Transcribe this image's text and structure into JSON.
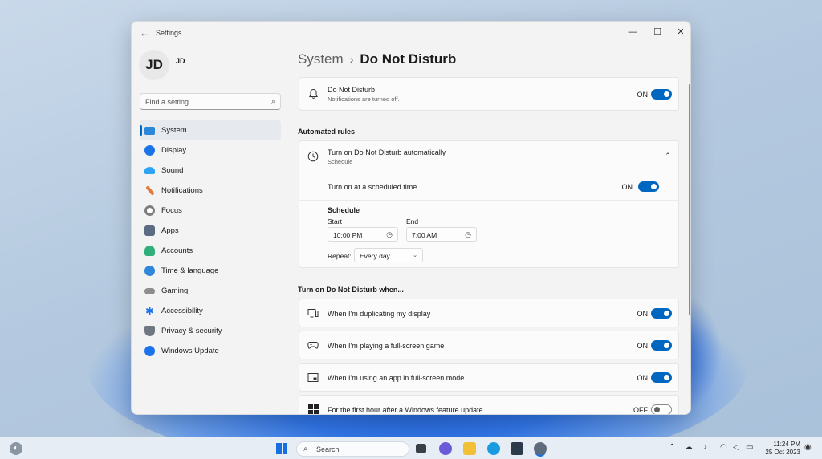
{
  "window": {
    "title": "Settings",
    "controls": {
      "minimize": "—",
      "maximize": "☐",
      "close": "✕"
    }
  },
  "user": {
    "initials": "JD",
    "name": "JD"
  },
  "search": {
    "placeholder": "Find a setting"
  },
  "sidebar": {
    "items": [
      {
        "label": "System",
        "icon": "system-icon",
        "color": "#2b88d8",
        "active": true
      },
      {
        "label": "Display",
        "icon": "bluetooth-icon",
        "color": "#1a73e8"
      },
      {
        "label": "Sound",
        "icon": "network-icon",
        "color": "#2ea3f2"
      },
      {
        "label": "Notifications",
        "icon": "personalization-brush-icon",
        "color": "#e07a3a"
      },
      {
        "label": "Focus",
        "icon": "focus-icon",
        "color": "#7d7d7d"
      },
      {
        "label": "Apps",
        "icon": "apps-icon",
        "color": "#5a6b82"
      },
      {
        "label": "Accounts",
        "icon": "accounts-icon",
        "color": "#2fb07a"
      },
      {
        "label": "Time & language",
        "icon": "time-language-icon",
        "color": "#2f87d9"
      },
      {
        "label": "Gaming",
        "icon": "gaming-icon",
        "color": "#8d8d8d"
      },
      {
        "label": "Accessibility",
        "icon": "accessibility-icon",
        "color": "#1a73e8"
      },
      {
        "label": "Privacy & security",
        "icon": "shield-icon",
        "color": "#6f7782"
      },
      {
        "label": "Windows Update",
        "icon": "windows-update-icon",
        "color": "#1a73e8"
      }
    ]
  },
  "breadcrumb": {
    "parent": "System",
    "separator": "›",
    "current": "Do Not Disturb"
  },
  "dnd": {
    "title": "Do Not Disturb",
    "subtitle": "Notifications are turned off.",
    "state": "ON"
  },
  "automated": {
    "heading": "Automated rules",
    "rule_title": "Turn on Do Not Disturb automatically",
    "rule_subtitle": "Schedule",
    "scheduled_label": "Turn on at a scheduled time",
    "scheduled_state": "ON",
    "schedule_heading": "Schedule",
    "start_label": "Start",
    "start_value": "10:00 PM",
    "end_label": "End",
    "end_value": "7:00 AM",
    "repeat_label": "Repeat:",
    "repeat_value": "Every day"
  },
  "when": {
    "heading": "Turn on Do Not Disturb when...",
    "items": [
      {
        "label": "When I'm duplicating my display",
        "state": "ON",
        "icon": "display-duplicate-icon"
      },
      {
        "label": "When I'm playing a full-screen game",
        "state": "ON",
        "icon": "gamepad-icon"
      },
      {
        "label": "When I'm using an app in full-screen mode",
        "state": "ON",
        "icon": "fullscreen-app-icon"
      },
      {
        "label": "For the first hour after a Windows feature update",
        "state": "OFF",
        "icon": "windows-logo-icon"
      }
    ]
  },
  "taskbar": {
    "search_label": "Search",
    "time": "11:24 PM",
    "date": "25 Oct 2023",
    "accent": "#1a6fe0"
  }
}
